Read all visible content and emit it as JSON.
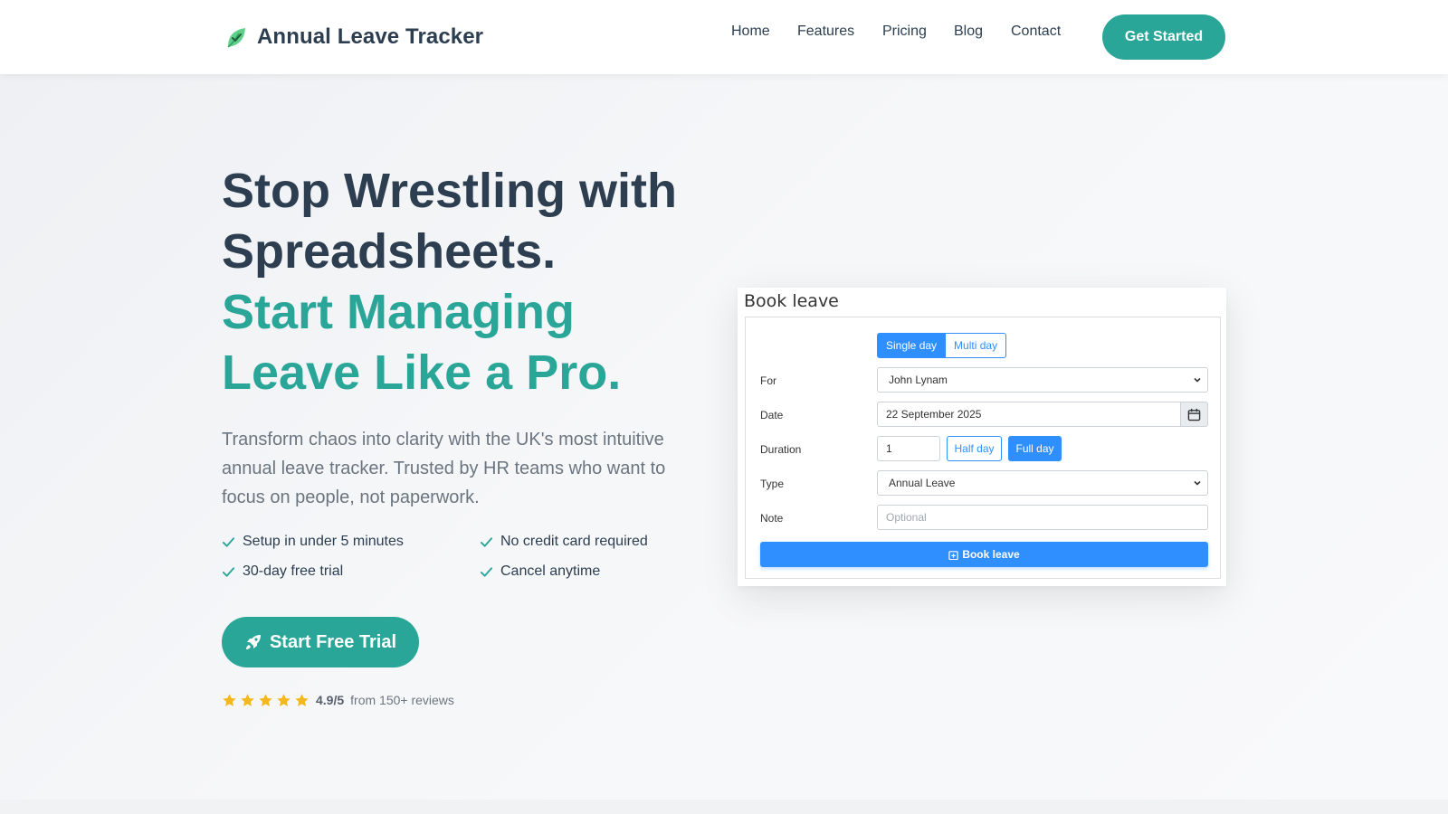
{
  "header": {
    "brand_name": "Annual Leave Tracker",
    "nav": [
      "Home",
      "Features",
      "Pricing",
      "Blog",
      "Contact"
    ],
    "cta_label": "Get Started"
  },
  "hero": {
    "title_line1": "Stop Wrestling with",
    "title_line2": "Spreadsheets.",
    "title_accent1": "Start Managing",
    "title_accent2": "Leave Like a Pro.",
    "description": "Transform chaos into clarity with the UK's most intuitive annual leave tracker. Trusted by HR teams who want to focus on people, not paperwork.",
    "features": [
      "Setup in under 5 minutes",
      "No credit card required",
      "30-day free trial",
      "Cancel anytime"
    ],
    "trial_label": "Start Free Trial",
    "rating": {
      "score": "4.9/5",
      "text": "from 150+ reviews",
      "stars": 5
    }
  },
  "booking": {
    "title": "Book leave",
    "toggle": {
      "single": "Single day",
      "multi": "Multi day"
    },
    "for_label": "For",
    "for_value": "John Lynam",
    "date_label": "Date",
    "date_value": "22 September 2025",
    "duration_label": "Duration",
    "duration_value": "1",
    "half_day": "Half day",
    "full_day": "Full day",
    "type_label": "Type",
    "type_value": "Annual Leave",
    "note_label": "Note",
    "note_placeholder": "Optional",
    "submit_label": "Book leave"
  },
  "colors": {
    "brand": "#2aa698",
    "dark_text": "#2c3e50",
    "primary_blue": "#2f8fff",
    "star": "#f5b81c"
  }
}
